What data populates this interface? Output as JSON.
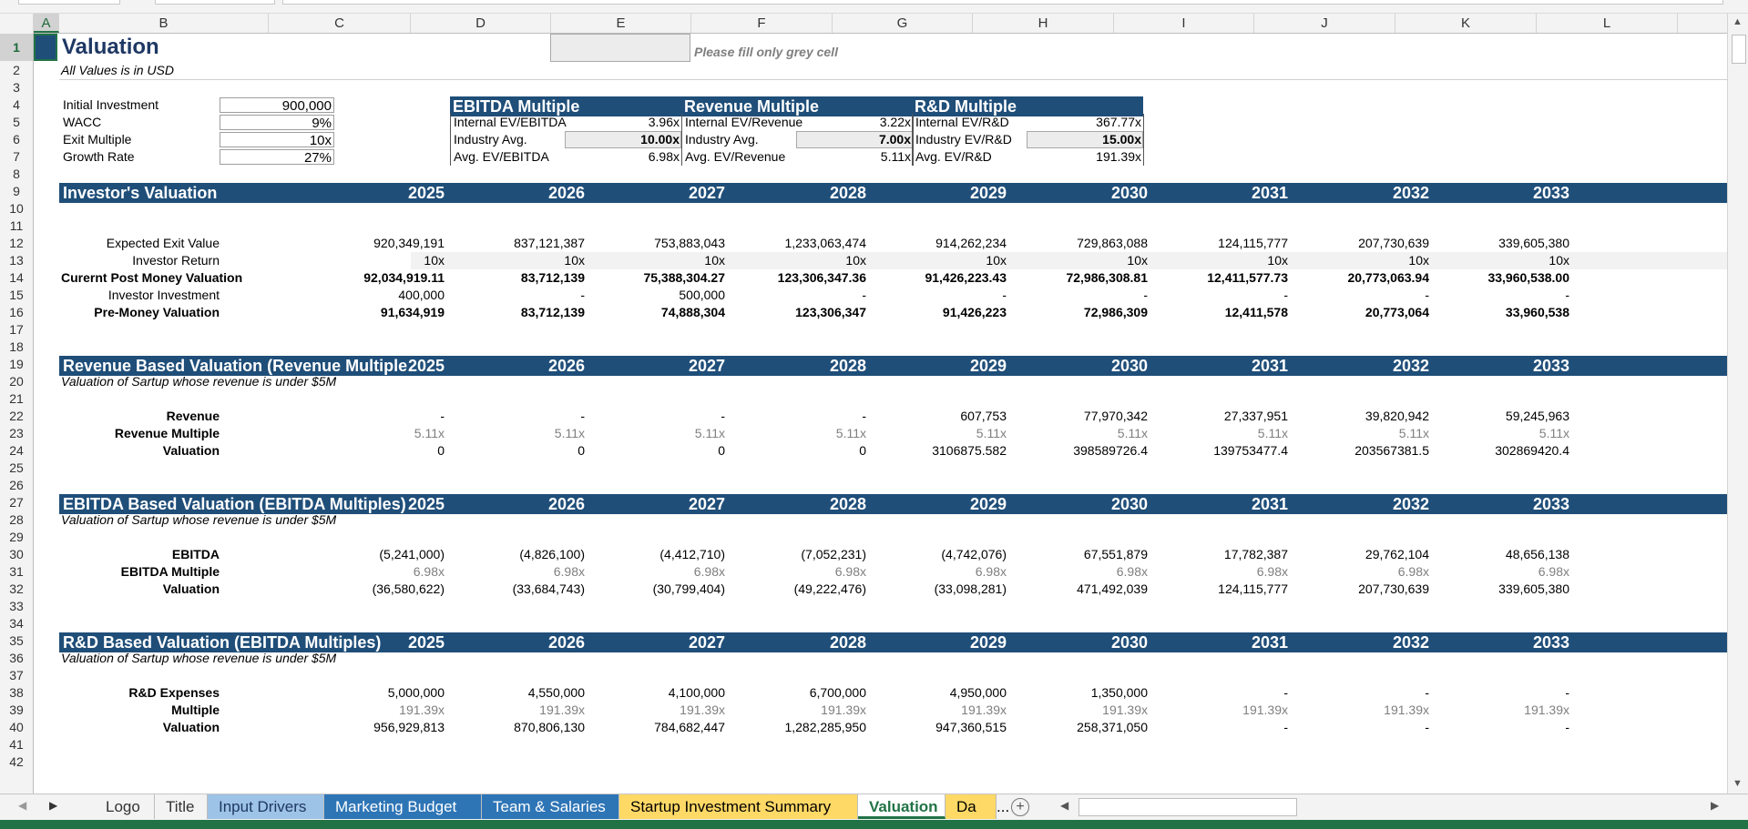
{
  "columns": [
    "A",
    "B",
    "C",
    "D",
    "E",
    "F",
    "G",
    "H",
    "I",
    "J",
    "K",
    "L"
  ],
  "rows": [
    "1",
    "2",
    "3",
    "4",
    "5",
    "6",
    "7",
    "8",
    "9",
    "10",
    "11",
    "12",
    "13",
    "14",
    "15",
    "16",
    "17",
    "18",
    "19",
    "20",
    "21",
    "22",
    "23",
    "24",
    "25",
    "26",
    "27",
    "28",
    "29",
    "30",
    "31",
    "32",
    "33",
    "34",
    "35",
    "36",
    "37",
    "38",
    "39",
    "40",
    "41",
    "42"
  ],
  "header": {
    "title": "Valuation",
    "subtitle": "All Values is in USD",
    "note": "Please fill only grey cell"
  },
  "inputs": [
    {
      "label": "Initial Investment",
      "value": "900,000"
    },
    {
      "label": "WACC",
      "value": "9%"
    },
    {
      "label": "Exit Multiple",
      "value": "10x"
    },
    {
      "label": "Growth Rate",
      "value": "27%"
    }
  ],
  "multiples": [
    {
      "title": "EBITDA Multiple",
      "rows": [
        [
          "Internal EV/EBITDA",
          "3.96x"
        ],
        [
          "Industry Avg.",
          "10.00x"
        ],
        [
          "Avg. EV/EBITDA",
          "6.98x"
        ]
      ]
    },
    {
      "title": "Revenue Multiple",
      "rows": [
        [
          "Internal EV/Revenue",
          "3.22x"
        ],
        [
          "Industry Avg.",
          "7.00x"
        ],
        [
          "Avg. EV/Revenue",
          "5.11x"
        ]
      ]
    },
    {
      "title": "R&D Multiple",
      "rows": [
        [
          "Internal EV/R&D",
          "367.77x"
        ],
        [
          "Industry EV/R&D",
          "15.00x"
        ],
        [
          "Avg. EV/R&D",
          "191.39x"
        ]
      ]
    }
  ],
  "years": [
    "2025",
    "2026",
    "2027",
    "2028",
    "2029",
    "2030",
    "2031",
    "2032",
    "2033"
  ],
  "investor": {
    "title": "Investor's Valuation",
    "rows": [
      {
        "label": "Expected Exit Value",
        "values": [
          "920,349,191",
          "837,121,387",
          "753,883,043",
          "1,233,063,474",
          "914,262,234",
          "729,863,088",
          "124,115,777",
          "207,730,639",
          "339,605,380"
        ]
      },
      {
        "label": "Investor Return",
        "values": [
          "10x",
          "10x",
          "10x",
          "10x",
          "10x",
          "10x",
          "10x",
          "10x",
          "10x"
        ]
      },
      {
        "label": "Curernt Post Money Valuation",
        "values": [
          "92,034,919.11",
          "83,712,139",
          "75,388,304.27",
          "123,306,347.36",
          "91,426,223.43",
          "72,986,308.81",
          "12,411,577.73",
          "20,773,063.94",
          "33,960,538.00"
        ]
      },
      {
        "label": "Investor Investment",
        "values": [
          "400,000",
          "-",
          "500,000",
          "-",
          "-",
          "-",
          "-",
          "-",
          "-"
        ]
      },
      {
        "label": "Pre-Money Valuation",
        "values": [
          "91,634,919",
          "83,712,139",
          "74,888,304",
          "123,306,347",
          "91,426,223",
          "72,986,309",
          "12,411,578",
          "20,773,064",
          "33,960,538"
        ]
      }
    ]
  },
  "revenue": {
    "title": "Revenue Based Valuation (Revenue Multiple",
    "subtitle": "Valuation of Sartup whose revenue is under $5M",
    "rows": [
      {
        "label": "Revenue",
        "values": [
          "-",
          "-",
          "-",
          "-",
          "607,753",
          "77,970,342",
          "27,337,951",
          "39,820,942",
          "59,245,963"
        ]
      },
      {
        "label": "Revenue Multiple",
        "values": [
          "5.11x",
          "5.11x",
          "5.11x",
          "5.11x",
          "5.11x",
          "5.11x",
          "5.11x",
          "5.11x",
          "5.11x"
        ]
      },
      {
        "label": "Valuation",
        "values": [
          "0",
          "0",
          "0",
          "0",
          "3106875.582",
          "398589726.4",
          "139753477.4",
          "203567381.5",
          "302869420.4"
        ]
      }
    ]
  },
  "ebitda": {
    "title": "EBITDA Based Valuation (EBITDA Multiples)",
    "subtitle": "Valuation of Sartup whose revenue is under $5M",
    "rows": [
      {
        "label": "EBITDA",
        "values": [
          "(5,241,000)",
          "(4,826,100)",
          "(4,412,710)",
          "(7,052,231)",
          "(4,742,076)",
          "67,551,879",
          "17,782,387",
          "29,762,104",
          "48,656,138"
        ]
      },
      {
        "label": "EBITDA Multiple",
        "values": [
          "6.98x",
          "6.98x",
          "6.98x",
          "6.98x",
          "6.98x",
          "6.98x",
          "6.98x",
          "6.98x",
          "6.98x"
        ]
      },
      {
        "label": "Valuation",
        "values": [
          "(36,580,622)",
          "(33,684,743)",
          "(30,799,404)",
          "(49,222,476)",
          "(33,098,281)",
          "471,492,039",
          "124,115,777",
          "207,730,639",
          "339,605,380"
        ]
      }
    ]
  },
  "rnd": {
    "title": "R&D  Based Valuation (EBITDA Multiples)",
    "subtitle": "Valuation of Sartup whose revenue is under $5M",
    "rows": [
      {
        "label": "R&D Expenses",
        "values": [
          "5,000,000",
          "4,550,000",
          "4,100,000",
          "6,700,000",
          "4,950,000",
          "1,350,000",
          "-",
          "-",
          "-"
        ]
      },
      {
        "label": "Multiple",
        "values": [
          "191.39x",
          "191.39x",
          "191.39x",
          "191.39x",
          "191.39x",
          "191.39x",
          "191.39x",
          "191.39x",
          "191.39x"
        ]
      },
      {
        "label": "Valuation",
        "values": [
          "956,929,813",
          "870,806,130",
          "784,682,447",
          "1,282,285,950",
          "947,360,515",
          "258,371,050",
          "-",
          "-",
          "-"
        ]
      }
    ]
  },
  "tabs": [
    {
      "label": "Logo",
      "color": "#f3f3f3",
      "text": "#333333"
    },
    {
      "label": "Title",
      "color": "#f3f3f3",
      "text": "#333333"
    },
    {
      "label": "Input Drivers",
      "color": "#9dc3e6",
      "text": "#1f3864"
    },
    {
      "label": "Marketing Budget",
      "color": "#2e75b6",
      "text": "#ffffff"
    },
    {
      "label": "Team & Salaries",
      "color": "#2e75b6",
      "text": "#ffffff"
    },
    {
      "label": "Startup Investment Summary",
      "color": "#ffd966",
      "text": "#000000"
    },
    {
      "label": "Valuation",
      "color": "#ffffff",
      "text": "#217346"
    },
    {
      "label": "Da",
      "color": "#ffd966",
      "text": "#000000"
    }
  ],
  "tab_more": "...",
  "colors": {
    "band": "#1f4e79",
    "accent": "#217346"
  }
}
